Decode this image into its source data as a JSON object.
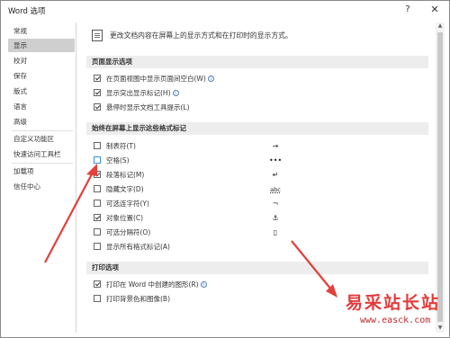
{
  "window": {
    "title": "Word 选项",
    "help_glyph": "?",
    "close_glyph": "✕"
  },
  "sidebar": {
    "items": [
      {
        "label": "常规"
      },
      {
        "label": "显示",
        "active": true
      },
      {
        "label": "校对"
      },
      {
        "label": "保存"
      },
      {
        "label": "版式"
      },
      {
        "label": "语言"
      },
      {
        "label": "高级"
      },
      {
        "label": "自定义功能区"
      },
      {
        "label": "快速访问工具栏"
      },
      {
        "label": "加载项"
      },
      {
        "label": "信任中心"
      }
    ]
  },
  "main": {
    "header_text": "更改文档内容在屏幕上的显示方式和在打印时的显示方式。",
    "sections": [
      {
        "title": "页面显示选项",
        "options": [
          {
            "label": "在页面视图中显示页面间空白(W)",
            "checked": true,
            "info": true
          },
          {
            "label": "显示突出显示标记(H)",
            "checked": true,
            "info": true
          },
          {
            "label": "悬停时显示文档工具提示(L)",
            "checked": true
          }
        ]
      },
      {
        "title": "始终在屏幕上显示这些格式标记",
        "options": [
          {
            "label": "制表符(T)",
            "checked": false,
            "symbol": "→"
          },
          {
            "label": "空格(S)",
            "checked": false,
            "symbol": "•••",
            "focused": true
          },
          {
            "label": "段落标记(M)",
            "checked": true,
            "symbol": "↵"
          },
          {
            "label": "隐藏文字(D)",
            "checked": false,
            "symbol": "abc"
          },
          {
            "label": "可选连字符(Y)",
            "checked": false,
            "symbol": "¬"
          },
          {
            "label": "对象位置(C)",
            "checked": true,
            "symbol": "⚓"
          },
          {
            "label": "可选分隔符(O)",
            "checked": false,
            "symbol": "▯"
          },
          {
            "label": "显示所有格式标记(A)",
            "checked": false
          }
        ]
      },
      {
        "title": "打印选项",
        "options": [
          {
            "label": "打印在 Word 中创建的图形(R)",
            "checked": true,
            "info": true
          },
          {
            "label": "打印背景色和图像(B)",
            "checked": false
          }
        ]
      }
    ]
  },
  "scrollbar": {
    "up_glyph": "▲",
    "down_glyph": "▼"
  },
  "watermark": {
    "text": "易采站长站",
    "url": "www.easck.com"
  },
  "colors": {
    "arrow": "#e2403a",
    "active_nav": "#cfcfcf",
    "section_bg": "#ededed",
    "info": "#4a7fc1"
  }
}
